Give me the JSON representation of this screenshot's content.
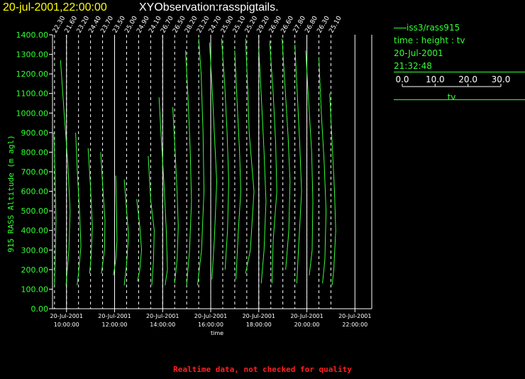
{
  "header": {
    "datetime": "20-jul-2001,22:00:00",
    "title": "XYObservation:rasspigtails."
  },
  "legend": {
    "series": "iss3/rass915",
    "plot_desc": "time : height : tv",
    "date": "20-Jul-2001",
    "time": "21:32:48",
    "scale_ticks": [
      "0.0",
      "10.0",
      "20.0",
      "30.0"
    ],
    "scale_label": "tv"
  },
  "footer": "Realtime data, not checked for quality",
  "colors": {
    "line": "#33ff33",
    "axis": "#ffffff",
    "header": "#ffff00",
    "footer": "#ff2020"
  },
  "chart_data": {
    "type": "line",
    "xlabel": "time",
    "ylabel": "915 RASS Altitude (m agl)",
    "ylim": [
      0,
      1400
    ],
    "y_ticks": [
      0,
      100,
      200,
      300,
      400,
      500,
      600,
      700,
      800,
      900,
      1000,
      1100,
      1200,
      1300,
      1400
    ],
    "xlim_hours": [
      9.4167,
      22.7
    ],
    "x_ticks": [
      {
        "hour": 10,
        "date": "20-Jul-2001",
        "time": "10:00:00"
      },
      {
        "hour": 12,
        "date": "20-Jul-2001",
        "time": "12:00:00"
      },
      {
        "hour": 14,
        "date": "20-Jul-2001",
        "time": "14:00:00"
      },
      {
        "hour": 16,
        "date": "20-Jul-2001",
        "time": "16:00:00"
      },
      {
        "hour": 18,
        "date": "20-Jul-2001",
        "time": "18:00:00"
      },
      {
        "hour": 20,
        "date": "20-Jul-2001",
        "time": "20:00:00"
      },
      {
        "hour": 22,
        "date": "20-Jul-2001",
        "time": "22:00:00"
      }
    ],
    "grid": "none",
    "profiles": [
      {
        "hour": 9.5,
        "label": "22.30",
        "points": [
          [
            -0.03,
            900
          ],
          [
            0.02,
            700
          ],
          [
            0.06,
            450
          ],
          [
            0.03,
            250
          ],
          [
            0.0,
            120
          ]
        ]
      },
      {
        "hour": 10.0,
        "label": "21.60",
        "points": [
          [
            -0.25,
            1270
          ],
          [
            -0.1,
            1000
          ],
          [
            0.05,
            750
          ],
          [
            0.15,
            500
          ],
          [
            0.1,
            300
          ],
          [
            -0.02,
            120
          ]
        ]
      },
      {
        "hour": 10.5,
        "label": "23.20",
        "points": [
          [
            -0.12,
            900
          ],
          [
            -0.05,
            700
          ],
          [
            0.04,
            500
          ],
          [
            0.1,
            320
          ],
          [
            0.0,
            180
          ],
          [
            -0.06,
            120
          ]
        ]
      },
      {
        "hour": 11.0,
        "label": "24.40",
        "points": [
          [
            -0.1,
            820
          ],
          [
            0.0,
            620
          ],
          [
            0.08,
            420
          ],
          [
            0.02,
            260
          ],
          [
            -0.04,
            180
          ]
        ]
      },
      {
        "hour": 11.5,
        "label": "23.70",
        "points": [
          [
            -0.08,
            800
          ],
          [
            0.02,
            600
          ],
          [
            0.1,
            450
          ],
          [
            0.08,
            300
          ],
          [
            -0.05,
            180
          ]
        ]
      },
      {
        "hour": 12.0,
        "label": "23.50",
        "points": [
          [
            0.05,
            680
          ],
          [
            0.08,
            500
          ],
          [
            0.1,
            350
          ],
          [
            0.05,
            250
          ],
          [
            -0.05,
            170
          ]
        ]
      },
      {
        "hour": 12.5,
        "label": "25.00",
        "points": [
          [
            -0.1,
            660
          ],
          [
            0.0,
            500
          ],
          [
            0.08,
            380
          ],
          [
            0.0,
            230
          ],
          [
            -0.1,
            120
          ]
        ]
      },
      {
        "hour": 13.0,
        "label": "24.90",
        "points": [
          [
            -0.08,
            560
          ],
          [
            0.05,
            420
          ],
          [
            0.12,
            300
          ],
          [
            0.05,
            200
          ],
          [
            -0.05,
            140
          ]
        ]
      },
      {
        "hour": 13.5,
        "label": "24.10",
        "points": [
          [
            -0.1,
            780
          ],
          [
            0.0,
            560
          ],
          [
            0.15,
            400
          ],
          [
            0.12,
            250
          ],
          [
            0.05,
            120
          ]
        ]
      },
      {
        "hour": 14.0,
        "label": "26.70",
        "points": [
          [
            -0.15,
            1080
          ],
          [
            -0.05,
            850
          ],
          [
            0.05,
            650
          ],
          [
            0.15,
            400
          ],
          [
            0.2,
            200
          ],
          [
            0.1,
            120
          ]
        ]
      },
      {
        "hour": 14.5,
        "label": "26.50",
        "points": [
          [
            -0.08,
            1030
          ],
          [
            0.02,
            800
          ],
          [
            0.1,
            600
          ],
          [
            0.15,
            420
          ],
          [
            0.1,
            250
          ],
          [
            0.0,
            130
          ]
        ]
      },
      {
        "hour": 15.0,
        "label": "28.20",
        "points": [
          [
            -0.05,
            1320
          ],
          [
            0.05,
            1100
          ],
          [
            0.15,
            800
          ],
          [
            0.2,
            550
          ],
          [
            0.12,
            300
          ],
          [
            0.0,
            120
          ]
        ]
      },
      {
        "hour": 15.5,
        "label": "23.20",
        "points": [
          [
            0.0,
            1380
          ],
          [
            0.1,
            1200
          ],
          [
            0.18,
            900
          ],
          [
            0.22,
            600
          ],
          [
            0.12,
            300
          ],
          [
            -0.05,
            120
          ]
        ]
      },
      {
        "hour": 16.0,
        "label": "24.70",
        "points": [
          [
            -0.05,
            1360
          ],
          [
            0.05,
            1150
          ],
          [
            0.15,
            900
          ],
          [
            0.25,
            650
          ],
          [
            0.15,
            350
          ],
          [
            0.05,
            150
          ]
        ]
      },
      {
        "hour": 16.5,
        "label": "25.90",
        "points": [
          [
            -0.05,
            1380
          ],
          [
            0.08,
            1150
          ],
          [
            0.18,
            900
          ],
          [
            0.25,
            650
          ],
          [
            0.2,
            400
          ],
          [
            0.1,
            200
          ]
        ]
      },
      {
        "hour": 17.0,
        "label": "25.10",
        "points": [
          [
            0.0,
            1320
          ],
          [
            0.1,
            1050
          ],
          [
            0.2,
            800
          ],
          [
            0.25,
            600
          ],
          [
            0.15,
            400
          ],
          [
            0.05,
            150
          ]
        ]
      },
      {
        "hour": 17.5,
        "label": "25.20",
        "points": [
          [
            -0.05,
            1380
          ],
          [
            0.05,
            1100
          ],
          [
            0.1,
            900
          ],
          [
            0.3,
            600
          ],
          [
            0.15,
            300
          ],
          [
            -0.05,
            180
          ]
        ]
      },
      {
        "hour": 18.0,
        "label": "29.20",
        "points": [
          [
            0.0,
            1330
          ],
          [
            0.12,
            1050
          ],
          [
            0.22,
            800
          ],
          [
            0.3,
            550
          ],
          [
            0.22,
            300
          ],
          [
            0.1,
            130
          ]
        ]
      },
      {
        "hour": 18.5,
        "label": "26.90",
        "points": [
          [
            -0.05,
            1370
          ],
          [
            0.1,
            1100
          ],
          [
            0.2,
            850
          ],
          [
            0.25,
            600
          ],
          [
            0.1,
            350
          ],
          [
            0.05,
            130
          ]
        ]
      },
      {
        "hour": 19.0,
        "label": "26.60",
        "points": [
          [
            -0.03,
            1380
          ],
          [
            0.1,
            1120
          ],
          [
            0.22,
            880
          ],
          [
            0.3,
            650
          ],
          [
            0.25,
            400
          ],
          [
            0.12,
            200
          ]
        ]
      },
      {
        "hour": 19.5,
        "label": "27.80",
        "points": [
          [
            0.0,
            1350
          ],
          [
            0.1,
            1100
          ],
          [
            0.2,
            850
          ],
          [
            0.28,
            600
          ],
          [
            0.15,
            300
          ],
          [
            0.08,
            130
          ]
        ]
      },
      {
        "hour": 20.0,
        "label": "26.80",
        "points": [
          [
            -0.05,
            1320
          ],
          [
            0.08,
            1050
          ],
          [
            0.2,
            800
          ],
          [
            0.25,
            550
          ],
          [
            0.22,
            300
          ],
          [
            0.1,
            170
          ]
        ]
      },
      {
        "hour": 20.5,
        "label": "26.30",
        "points": [
          [
            0.0,
            1280
          ],
          [
            0.1,
            1000
          ],
          [
            0.22,
            750
          ],
          [
            0.3,
            500
          ],
          [
            0.25,
            250
          ],
          [
            0.15,
            130
          ]
        ]
      },
      {
        "hour": 21.0,
        "label": "25.10",
        "points": [
          [
            -0.05,
            1100
          ],
          [
            0.05,
            850
          ],
          [
            0.15,
            600
          ],
          [
            0.2,
            400
          ],
          [
            0.12,
            200
          ],
          [
            0.05,
            120
          ]
        ]
      }
    ]
  }
}
